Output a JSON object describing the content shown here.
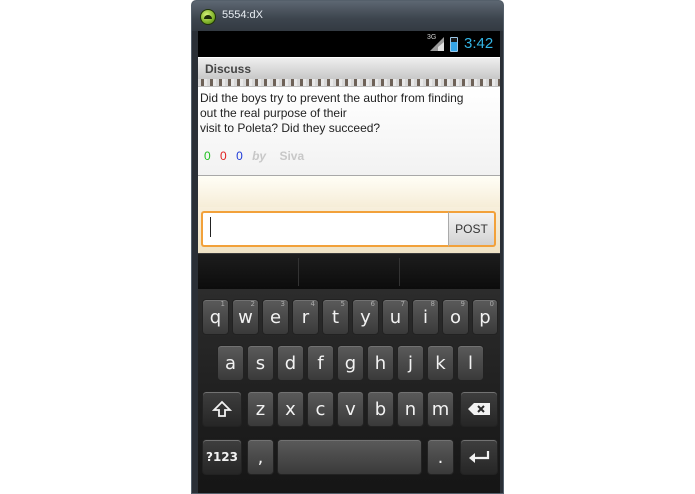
{
  "window": {
    "title": "5554:dX"
  },
  "status_bar": {
    "network": "3G",
    "time": "3:42"
  },
  "app_bar": {
    "title": "Discuss"
  },
  "post": {
    "question": "Did the boys try to prevent the author from finding\nout the real purpose of their\nvisit to Poleta? Did they succeed?",
    "count_green": "0",
    "count_red": "0",
    "count_blue": "0",
    "by_label": "by",
    "author": "Siva"
  },
  "compose": {
    "input_value": "",
    "post_label": "POST"
  },
  "keyboard": {
    "row1": [
      {
        "key": "q",
        "hint": "1"
      },
      {
        "key": "w",
        "hint": "2"
      },
      {
        "key": "e",
        "hint": "3"
      },
      {
        "key": "r",
        "hint": "4"
      },
      {
        "key": "t",
        "hint": "5"
      },
      {
        "key": "y",
        "hint": "6"
      },
      {
        "key": "u",
        "hint": "7"
      },
      {
        "key": "i",
        "hint": "8"
      },
      {
        "key": "o",
        "hint": "9"
      },
      {
        "key": "p",
        "hint": "0"
      }
    ],
    "row2": [
      "a",
      "s",
      "d",
      "f",
      "g",
      "h",
      "j",
      "k",
      "l"
    ],
    "row3": [
      "z",
      "x",
      "c",
      "v",
      "b",
      "n",
      "m"
    ],
    "symbols_label": "?123",
    "comma": ",",
    "period": ".",
    "icons": {
      "shift": "shift-icon",
      "delete": "backspace-icon",
      "enter": "enter-icon"
    }
  },
  "colors": {
    "accent": "#33b5e5",
    "focus_border": "#f2a13a",
    "green": "#20c020",
    "red": "#e02020",
    "blue": "#1e3ad8"
  }
}
